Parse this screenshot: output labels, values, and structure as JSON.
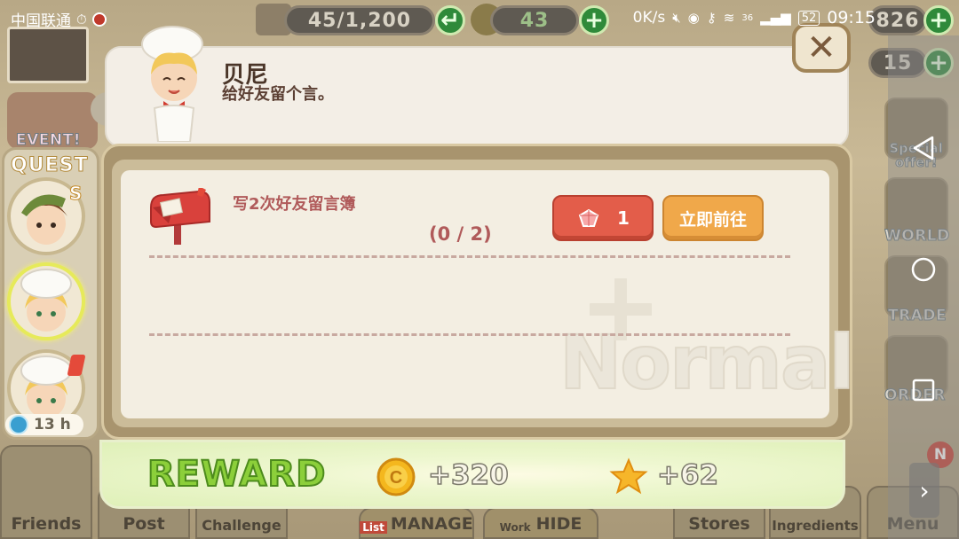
{
  "status_bar": {
    "carrier": "中国联通",
    "net_speed": "0K/s",
    "signal": "36",
    "battery": "52",
    "time": "09:15"
  },
  "hud": {
    "storage": "45/1,200",
    "energy": "43",
    "coins": "826",
    "gems": "15"
  },
  "side_menu": {
    "event": "EVENT!",
    "special_offer": "Special offer!",
    "world": "WORLD",
    "trade": "TRADE",
    "order": "ORDER",
    "badge": "N"
  },
  "bottom_tabs": {
    "friends": "Friends",
    "post": "Post",
    "challenge": "Challenge",
    "manage": "MANAGE",
    "list": "List",
    "hide": "HIDE",
    "work": "Work",
    "stores": "Stores",
    "ingredients": "Ingredients",
    "menu": "Menu"
  },
  "quest_list": {
    "title": "QUEST",
    "timer": "13  h"
  },
  "npc": {
    "name": "贝尼",
    "line": "给好友留个言。"
  },
  "task": {
    "description": "写2次好友留言簿",
    "progress": "(0 / 2)",
    "cost": "1",
    "go_label": "立即前往"
  },
  "difficulty": "Normal",
  "reward": {
    "label": "REWARD",
    "coins": "+320",
    "exp": "+62"
  },
  "colors": {
    "reward_green": "#8ccf3a",
    "task_red": "#b05a5a",
    "cost_button": "#e35d4a",
    "go_button": "#f0a84a"
  }
}
